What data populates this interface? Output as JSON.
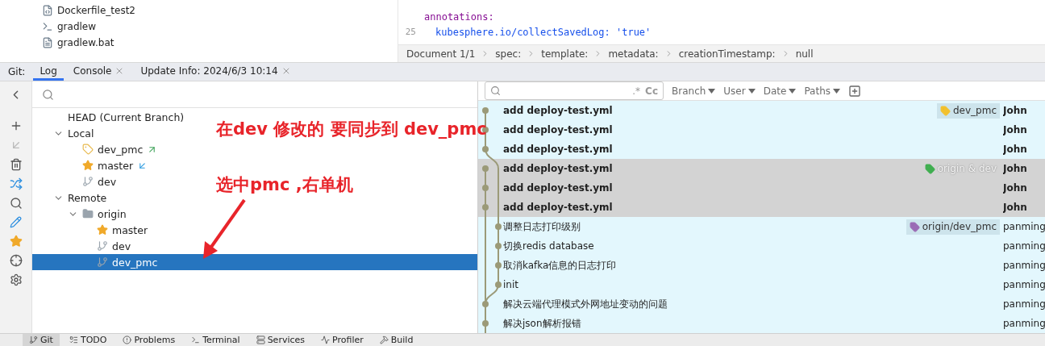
{
  "project_files": [
    {
      "name": "Dockerfile_test2",
      "kind": "docker"
    },
    {
      "name": "gradlew",
      "kind": "script"
    },
    {
      "name": "gradlew.bat",
      "kind": "text"
    }
  ],
  "editor": {
    "lines": [
      {
        "text": "annotations:",
        "kind": "key"
      },
      {
        "number": "25",
        "text": "kubesphere.io/collectSavedLog: 'true'",
        "kind": "pair"
      }
    ],
    "breadcrumb": [
      "Document 1/1",
      "spec:",
      "template:",
      "metadata:",
      "creationTimestamp:",
      "null"
    ]
  },
  "tool_window": {
    "title": "Git:",
    "tabs": [
      {
        "label": "Log",
        "selected": true,
        "closable": false
      },
      {
        "label": "Console",
        "selected": false,
        "closable": true
      },
      {
        "label": "Update Info: 2024/6/3 10:14",
        "selected": false,
        "closable": true
      }
    ]
  },
  "branches": [
    {
      "label": "HEAD (Current Branch)",
      "selected": false
    },
    {
      "label": "Local",
      "expanded": true,
      "selected": false,
      "children": [
        {
          "label": "dev_pmc",
          "kind": "tag",
          "outgoing": true,
          "selected": false
        },
        {
          "label": "master",
          "kind": "star",
          "incoming": true,
          "selected": false
        },
        {
          "label": "dev",
          "kind": "branch",
          "selected": false
        }
      ]
    },
    {
      "label": "Remote",
      "expanded": true,
      "selected": false,
      "children": [
        {
          "label": "origin",
          "kind": "folder",
          "expanded": true,
          "selected": false,
          "children": [
            {
              "label": "master",
              "kind": "star",
              "selected": false
            },
            {
              "label": "dev",
              "kind": "branch",
              "selected": false
            },
            {
              "label": "dev_pmc",
              "kind": "branch",
              "selected": true
            }
          ]
        }
      ]
    }
  ],
  "log_filters": [
    "Branch",
    "User",
    "Date",
    "Paths"
  ],
  "search_field": {
    "regex": ".*",
    "case": "Cc"
  },
  "commits": [
    {
      "subject": "add deploy-test.yml",
      "author": "John",
      "bold": true,
      "selected": false,
      "ref": {
        "label": "dev_pmc",
        "color": "#f2c12e"
      }
    },
    {
      "subject": "add deploy-test.yml",
      "author": "John",
      "bold": true,
      "selected": false
    },
    {
      "subject": "add deploy-test.yml",
      "author": "John",
      "bold": true,
      "selected": false
    },
    {
      "subject": "add deploy-test.yml",
      "author": "John",
      "bold": true,
      "selected": true,
      "ref": {
        "label": "origin & dev",
        "color": "#3fae4f"
      }
    },
    {
      "subject": "add deploy-test.yml",
      "author": "John",
      "bold": true,
      "selected": true
    },
    {
      "subject": "add deploy-test.yml",
      "author": "John",
      "bold": true,
      "selected": true
    },
    {
      "subject": "调整日志打印级别",
      "author": "panming",
      "bold": false,
      "selected": false,
      "ref": {
        "label": "origin/dev_pmc",
        "color": "#9b6bb5"
      }
    },
    {
      "subject": "切换redis database",
      "author": "panming",
      "bold": false,
      "selected": false
    },
    {
      "subject": "取消kafka信息的日志打印",
      "author": "panming",
      "bold": false,
      "selected": false
    },
    {
      "subject": "init",
      "author": "panming",
      "bold": false,
      "selected": false
    },
    {
      "subject": "解决云端代理模式外网地址变动的问题",
      "author": "panming",
      "bold": false,
      "selected": false
    },
    {
      "subject": "解决json解析报错",
      "author": "panming",
      "bold": false,
      "selected": false
    }
  ],
  "annotations": [
    "在dev 修改的 要同步到 dev_pmc",
    "选中pmc ,右单机"
  ],
  "bottom_tabs": [
    {
      "label": "Git",
      "selected": true
    },
    {
      "label": "TODO",
      "selected": false
    },
    {
      "label": "Problems",
      "selected": false
    },
    {
      "label": "Terminal",
      "selected": false
    },
    {
      "label": "Services",
      "selected": false
    },
    {
      "label": "Profiler",
      "selected": false
    },
    {
      "label": "Build",
      "selected": false
    }
  ]
}
